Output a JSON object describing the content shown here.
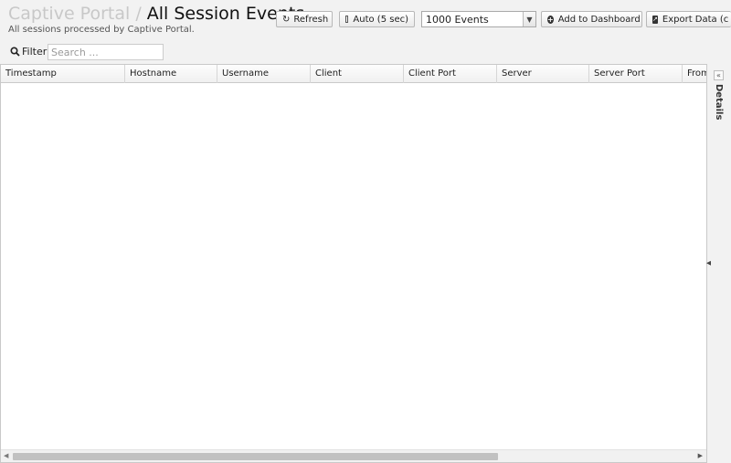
{
  "header": {
    "crumb": "Captive Portal",
    "separator": "/",
    "title": "All Session Events",
    "subtitle": "All sessions processed by Captive Portal."
  },
  "toolbar": {
    "refresh_label": "Refresh",
    "auto_label": "Auto (5 sec)",
    "events_select_value": "1000 Events",
    "add_dashboard_label": "Add to Dashboard",
    "export_label": "Export Data (c"
  },
  "filter": {
    "label": "Filter",
    "placeholder": "Search ..."
  },
  "grid": {
    "columns": [
      "Timestamp",
      "Hostname",
      "Username",
      "Client",
      "Client Port",
      "Server",
      "Server Port",
      "From"
    ]
  },
  "details": {
    "label": "Details"
  },
  "icons": {
    "refresh": "refresh-icon",
    "auto": "checkbox-icon",
    "add": "plus-circle-icon",
    "export": "export-icon",
    "search": "search-icon",
    "collapse": "double-chevron-left-icon"
  }
}
